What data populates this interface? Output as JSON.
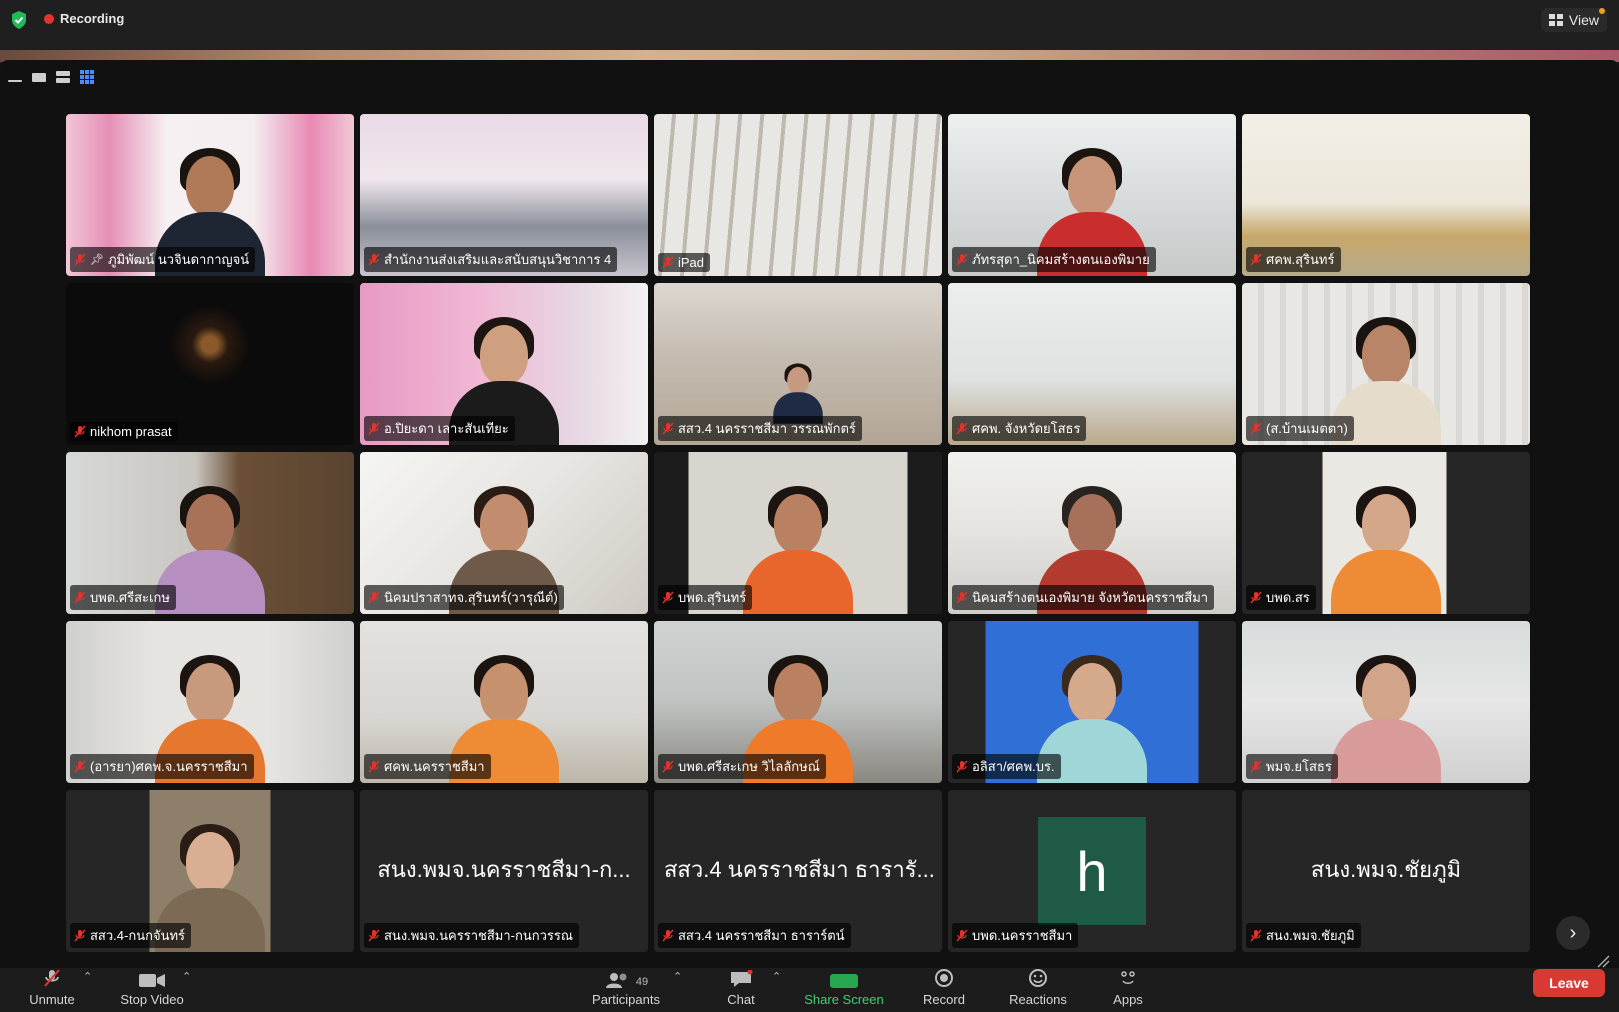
{
  "topbar": {
    "recording_label": "Recording",
    "view_label": "View"
  },
  "tiles": [
    {
      "name": "ภูมิพัฒน์ นวจินดากาญจน์",
      "pinned": true,
      "scene": "pink-office",
      "person": "man-suit"
    },
    {
      "name": "สำนักงานส่งเสริมและสนับสนุนวิชาการ 4",
      "active": true,
      "scene": "room-group",
      "person": "none"
    },
    {
      "name": "iPad",
      "scene": "ceiling",
      "person": "none"
    },
    {
      "name": "ภัทรสุดา_นิคมสร้างตนเองพิมาย",
      "scene": "office-white",
      "person": "woman-glasses"
    },
    {
      "name": "ศคพ.สุรินทร์",
      "scene": "sign-room",
      "person": "none"
    },
    {
      "name": "nikhom prasat",
      "scene": "dark",
      "person": "none"
    },
    {
      "name": "อ.ปิยะดา เลาะสันเทียะ",
      "scene": "pink-curtain",
      "person": "woman-close"
    },
    {
      "name": "สสว.4 นครราชสีมา วรรณพักตร์",
      "scene": "stairs",
      "person": "woman-small"
    },
    {
      "name": "ศคพ. จังหวัดยโสธร",
      "scene": "white-room",
      "person": "none"
    },
    {
      "name": "(ส.บ้านเมตตา)",
      "scene": "light-curtain",
      "person": "woman-glasses2"
    },
    {
      "name": "บพด.ศรีสะเกษ",
      "scene": "office-shelf",
      "person": "woman-purple"
    },
    {
      "name": "นิคมปราสาทจ.สุรินทร์(วารุณีต์)",
      "scene": "bright-office",
      "person": "woman-glasses3"
    },
    {
      "name": "บพด.สุรินทร์",
      "scene": "portrait-dark",
      "person": "woman-orange"
    },
    {
      "name": "นิคมสร้างตนเองพิมาย จังหวัดนครราชสีมา",
      "scene": "office-white2",
      "person": "man-glasses"
    },
    {
      "name": "บพด.สร",
      "scene": "portrait-light",
      "person": "woman-orange2"
    },
    {
      "name": "(อารยา)ศคพ.จ.นครราชสีมา",
      "scene": "flag-room",
      "person": "woman-orange3"
    },
    {
      "name": "ศคพ.นครราชสีมา",
      "scene": "board-room",
      "person": "woman-orange4"
    },
    {
      "name": "บพด.ศรีสะเกษ วิไลลักษณ์",
      "scene": "busy-office",
      "person": "woman-orange5"
    },
    {
      "name": "อลิสา/ศคพ.บร.",
      "scene": "blue-bg",
      "person": "woman-blue"
    },
    {
      "name": "พมจ.ยโสธร",
      "scene": "ceiling-office",
      "person": "woman-pink"
    },
    {
      "name": "สสว.4-กนกจันทร์",
      "scene": "portrait-shop",
      "person": "woman-mask"
    },
    {
      "name": "สนง.พมจ.นครราชสีมา-กนกวรรณ",
      "big": "สนง.พมจ.นครราชสีมา-ก...",
      "scene": "blank",
      "person": "none"
    },
    {
      "name": "สสว.4 นครราชสีมา ธาราร์ตน์",
      "big": "สสว.4 นครราชสีมา ธารารั...",
      "scene": "blank",
      "person": "none"
    },
    {
      "name": "บพด.นครราชสีมา",
      "avatar": "h",
      "scene": "blank",
      "person": "none"
    },
    {
      "name": "สนง.พมจ.ชัยภูมิ",
      "big": "สนง.พมจ.ชัยภูมิ",
      "scene": "blank",
      "person": "none"
    }
  ],
  "toolbar": {
    "unmute_label": "Unmute",
    "stop_video_label": "Stop Video",
    "participants_label": "Participants",
    "participants_count": "49",
    "chat_label": "Chat",
    "share_label": "Share Screen",
    "record_label": "Record",
    "reactions_label": "Reactions",
    "apps_label": "Apps",
    "leave_label": "Leave"
  },
  "colors": {
    "active_speaker": "#2bd160",
    "leave": "#d83a33",
    "share": "#26a750"
  }
}
